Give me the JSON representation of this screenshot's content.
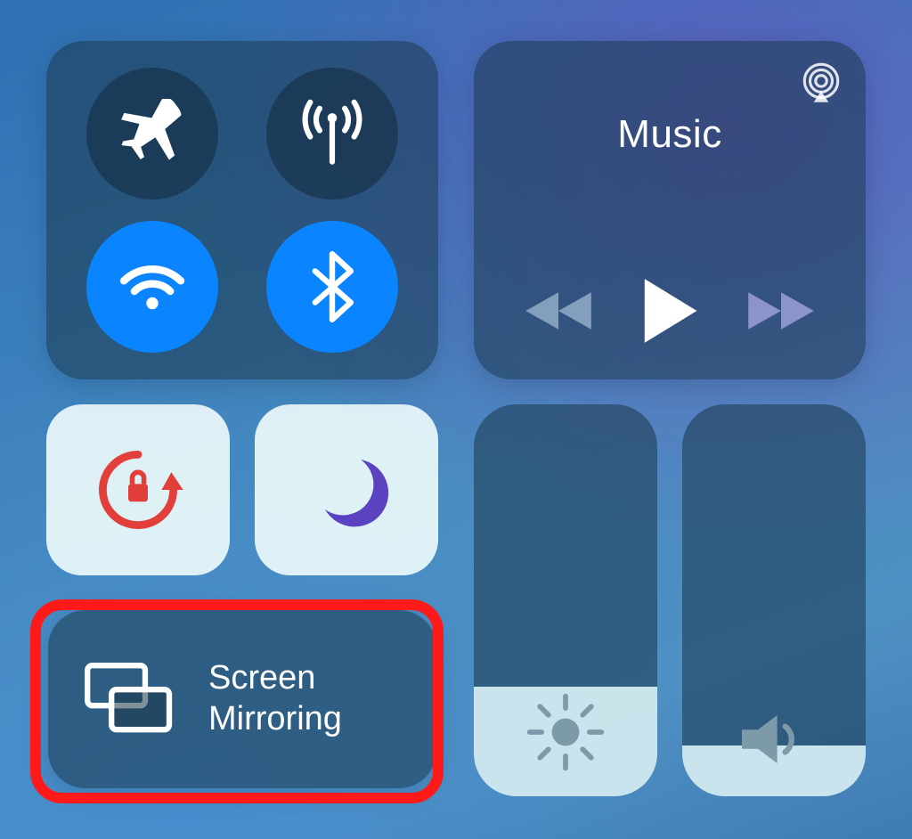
{
  "connectivity": {
    "airplane": {
      "on": false,
      "name": "airplane-mode-toggle"
    },
    "cellular": {
      "on": false,
      "name": "cellular-data-toggle"
    },
    "wifi": {
      "on": true,
      "name": "wifi-toggle"
    },
    "bluetooth": {
      "on": true,
      "name": "bluetooth-toggle"
    }
  },
  "music": {
    "title": "Music",
    "airplay_icon": "airplay-icon",
    "rewind": "rewind-button",
    "play": "play-button",
    "forward": "forward-button"
  },
  "orientation_lock": {
    "locked": true,
    "name": "orientation-lock-toggle"
  },
  "do_not_disturb": {
    "on": true,
    "name": "do-not-disturb-toggle"
  },
  "screen_mirroring": {
    "label_line1": "Screen",
    "label_line2": "Mirroring",
    "highlighted": true,
    "name": "screen-mirroring-button"
  },
  "brightness": {
    "level": 0.28,
    "name": "brightness-slider"
  },
  "volume": {
    "level": 0.13,
    "name": "volume-slider"
  },
  "colors": {
    "accent_blue": "#0a84ff",
    "highlight_red": "#ff1a1a",
    "dnd_purple": "#5b42c0",
    "lock_red": "#e23f3b"
  }
}
